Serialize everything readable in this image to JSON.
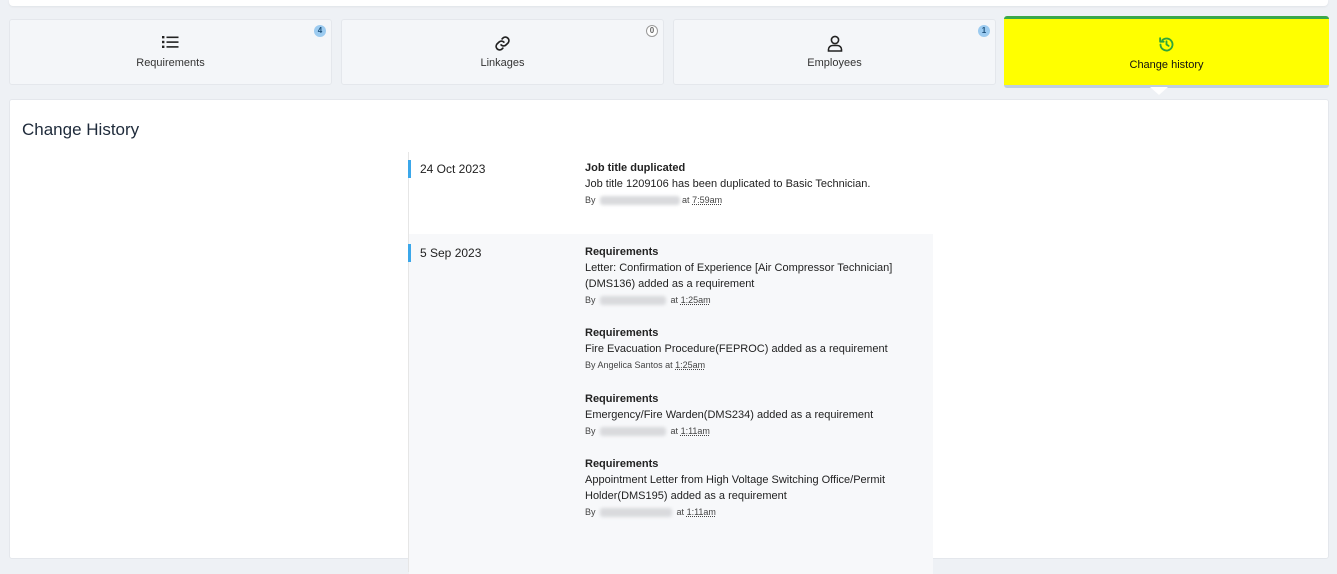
{
  "tabs": [
    {
      "label": "Requirements",
      "icon": "list-icon",
      "badge": "4",
      "badge_style": "filled"
    },
    {
      "label": "Linkages",
      "icon": "link-icon",
      "badge": "0",
      "badge_style": "outline"
    },
    {
      "label": "Employees",
      "icon": "user-icon",
      "badge": "1",
      "badge_style": "filled"
    },
    {
      "label": "Change history",
      "icon": "history-icon",
      "active": true
    }
  ],
  "panel": {
    "title": "Change History"
  },
  "timeline": [
    {
      "date": "24 Oct 2023",
      "entries": [
        {
          "title": "Job title duplicated",
          "description": "Job title 1209106 has been duplicated to Basic Technician.",
          "by_prefix": "By",
          "by_name": "",
          "at": "at",
          "time": "7:59am"
        }
      ]
    },
    {
      "date": "5 Sep 2023",
      "entries": [
        {
          "title": "Requirements",
          "description": "Letter: Confirmation of Experience [Air Compressor Technician] (DMS136) added as a requirement",
          "by_prefix": "By",
          "by_name": "",
          "at": "at",
          "time": "1:25am"
        },
        {
          "title": "Requirements",
          "description": "Fire Evacuation Procedure(FEPROC) added as a requirement",
          "by_prefix": "By",
          "by_name": "Angelica Santos",
          "at": "at",
          "time": "1:25am"
        },
        {
          "title": "Requirements",
          "description": "Emergency/Fire Warden(DMS234) added as a requirement",
          "by_prefix": "By",
          "by_name": "",
          "at": "at",
          "time": "1:11am"
        },
        {
          "title": "Requirements",
          "description": "Appointment Letter from High Voltage Switching Office/Permit Holder(DMS195) added as a requirement",
          "by_prefix": "By",
          "by_name": "",
          "at": "at",
          "time": "1:11am"
        }
      ]
    }
  ],
  "colors": {
    "active_tab": "#ffff00",
    "active_tab_border": "#3aa84a",
    "timeline_marker": "#3ba7ea",
    "badge": "#9ccbf0",
    "history_icon": "#2fa53a"
  }
}
